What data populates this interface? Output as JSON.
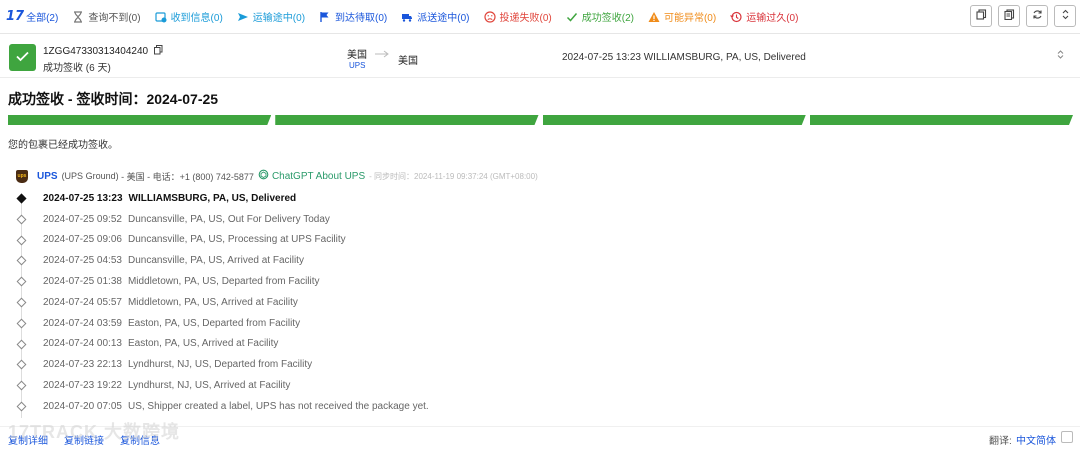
{
  "filters": {
    "logo": "17",
    "tabs": [
      {
        "label": "全部(2)",
        "icon": "logo",
        "color": "#1a56db"
      },
      {
        "label": "查询不到(0)",
        "icon": "hourglass-icon",
        "color": "#555555"
      },
      {
        "label": "收到信息(0)",
        "icon": "info-received-icon",
        "color": "#1a9bd8"
      },
      {
        "label": "运输途中(0)",
        "icon": "airplane-icon",
        "color": "#1a9bd8"
      },
      {
        "label": "到达待取(0)",
        "icon": "flag-icon",
        "color": "#1a56db"
      },
      {
        "label": "派送途中(0)",
        "icon": "delivery-truck-icon",
        "color": "#1a56db"
      },
      {
        "label": "投递失败(0)",
        "icon": "sad-face-icon",
        "color": "#e0463c"
      },
      {
        "label": "成功签收(2)",
        "icon": "check-icon",
        "color": "#3fa53f"
      },
      {
        "label": "可能异常(0)",
        "icon": "warning-icon",
        "color": "#f08c1a"
      },
      {
        "label": "运输过久(0)",
        "icon": "clock-history-icon",
        "color": "#d9343b"
      }
    ]
  },
  "package": {
    "tracking_number": "1ZGG47330313404240",
    "status": "成功签收 (6 天)",
    "origin_country": "美国",
    "carrier_short": "UPS",
    "dest_country": "美国",
    "last_event": "2024-07-25 13:23  WILLIAMSBURG, PA, US, Delivered",
    "status_color": "#3fa53f"
  },
  "detail": {
    "title": "成功签收 - 签收时间：2024-07-25",
    "description": "您的包裹已经成功签收。",
    "progress_segments": 4
  },
  "carrier": {
    "name": "UPS",
    "service": "(UPS Ground)",
    "country": "- 美国 -",
    "phone": "电话：+1 (800) 742-5877",
    "chatgpt": "ChatGPT About UPS",
    "sync": "- 同步时间：2024-11-19 09:37:24 (GMT+08:00)"
  },
  "events": [
    {
      "time": "2024-07-25 13:23",
      "desc": "WILLIAMSBURG, PA, US, Delivered"
    },
    {
      "time": "2024-07-25 09:52",
      "desc": "Duncansville, PA, US, Out For Delivery Today"
    },
    {
      "time": "2024-07-25 09:06",
      "desc": "Duncansville, PA, US, Processing at UPS Facility"
    },
    {
      "time": "2024-07-25 04:53",
      "desc": "Duncansville, PA, US, Arrived at Facility"
    },
    {
      "time": "2024-07-25 01:38",
      "desc": "Middletown, PA, US, Departed from Facility"
    },
    {
      "time": "2024-07-24 05:57",
      "desc": "Middletown, PA, US, Arrived at Facility"
    },
    {
      "time": "2024-07-24 03:59",
      "desc": "Easton, PA, US, Departed from Facility"
    },
    {
      "time": "2024-07-24 00:13",
      "desc": "Easton, PA, US, Arrived at Facility"
    },
    {
      "time": "2024-07-23 22:13",
      "desc": "Lyndhurst, NJ, US, Departed from Facility"
    },
    {
      "time": "2024-07-23 19:22",
      "desc": "Lyndhurst, NJ, US, Arrived at Facility"
    },
    {
      "time": "2024-07-20 07:05",
      "desc": "US, Shipper created a label, UPS has not received the package yet."
    }
  ],
  "footer": {
    "copy_detail": "复制详细",
    "copy_link": "复制链接",
    "copy_info": "复制信息",
    "translate_label": "翻译:",
    "language": "中文简体"
  },
  "watermark": "17TRACK 大数跨境"
}
